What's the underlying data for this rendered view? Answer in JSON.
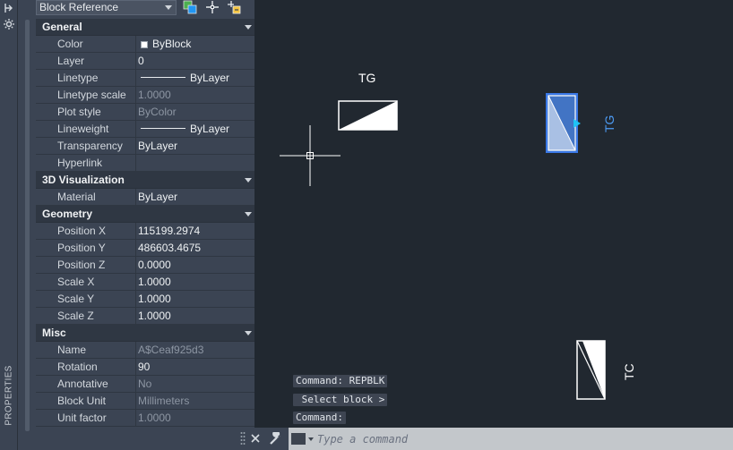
{
  "palette": {
    "title": "PROPERTIES",
    "object_type": "Block Reference",
    "sections": [
      {
        "title": "General",
        "rows": [
          {
            "name": "Color",
            "value": "ByBlock",
            "kind": "swatch"
          },
          {
            "name": "Layer",
            "value": "0"
          },
          {
            "name": "Linetype",
            "value": "ByLayer",
            "kind": "line"
          },
          {
            "name": "Linetype scale",
            "value": "1.0000",
            "readonly": true
          },
          {
            "name": "Plot style",
            "value": "ByColor",
            "readonly": true
          },
          {
            "name": "Lineweight",
            "value": "ByLayer",
            "kind": "line"
          },
          {
            "name": "Transparency",
            "value": "ByLayer"
          },
          {
            "name": "Hyperlink",
            "value": ""
          }
        ]
      },
      {
        "title": "3D Visualization",
        "rows": [
          {
            "name": "Material",
            "value": "ByLayer"
          }
        ]
      },
      {
        "title": "Geometry",
        "rows": [
          {
            "name": "Position X",
            "value": "115199.2974"
          },
          {
            "name": "Position Y",
            "value": "486603.4675"
          },
          {
            "name": "Position Z",
            "value": "0.0000"
          },
          {
            "name": "Scale X",
            "value": "1.0000"
          },
          {
            "name": "Scale Y",
            "value": "1.0000"
          },
          {
            "name": "Scale Z",
            "value": "1.0000"
          }
        ]
      },
      {
        "title": "Misc",
        "rows": [
          {
            "name": "Name",
            "value": "A$Ceaf925d3",
            "readonly": true
          },
          {
            "name": "Rotation",
            "value": "90"
          },
          {
            "name": "Annotative",
            "value": "No",
            "readonly": true
          },
          {
            "name": "Block Unit",
            "value": "Millimeters",
            "readonly": true
          },
          {
            "name": "Unit factor",
            "value": "1.0000",
            "readonly": true
          }
        ]
      }
    ]
  },
  "canvas": {
    "labels": {
      "block1": "TG",
      "block2": "TG",
      "block3": "TC"
    }
  },
  "command": {
    "history": [
      "Command: REPBLK",
      " Select block >",
      "Command:"
    ],
    "placeholder": "Type a command"
  },
  "colors": {
    "background": "#212830",
    "palette": "#3b4453",
    "selection": "#4d8df5"
  }
}
